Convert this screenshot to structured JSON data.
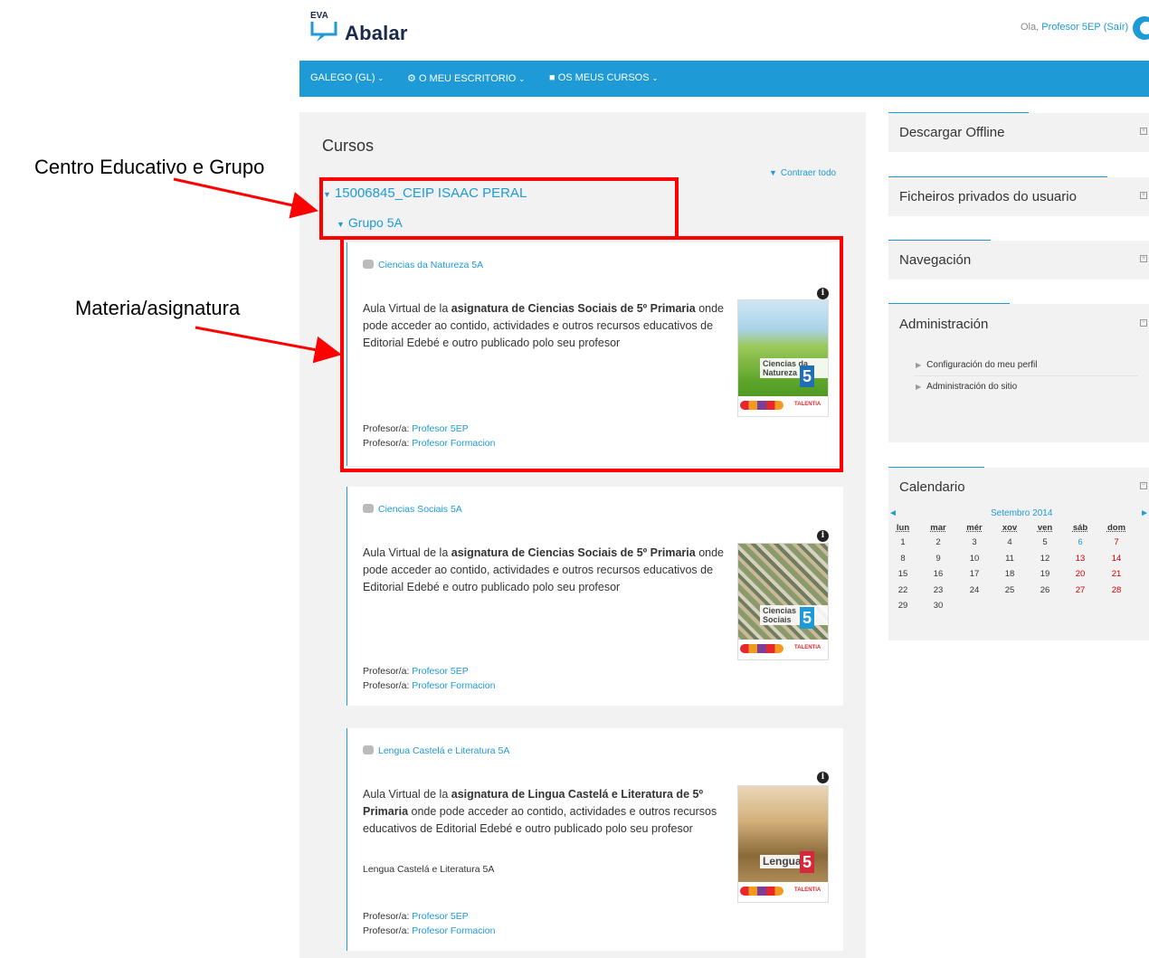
{
  "header": {
    "logo_small": "EVA",
    "logo_name": "Abalar",
    "greeting_prefix": "Ola, ",
    "user_name": "Profesor 5EP",
    "logout_label": "(Saír)"
  },
  "navbar": {
    "items": [
      {
        "label": "GALEGO (GL)",
        "icon": "chevron-down-icon"
      },
      {
        "label": "O MEU ESCRITORIO",
        "icon": "dashboard-icon"
      },
      {
        "label": "OS MEUS CURSOS",
        "icon": "briefcase-icon"
      }
    ]
  },
  "main": {
    "title": "Cursos",
    "collapse_all": "Contraer todo",
    "school": "15006845_CEIP ISAAC PERAL",
    "group": "Grupo 5A",
    "courses": [
      {
        "name": "Ciencias da Natureza 5A",
        "desc_plain_1": "Aula Virtual de la ",
        "desc_bold": "asignatura de Ciencias Sociais de 5º Primaria",
        "desc_plain_2": " onde pode acceder ao contido, actividades e outros recursos educativos de Editorial Edebé e outro publicado polo seu profesor",
        "teacher_label": "Profesor/a:",
        "teachers": [
          "Profesor 5EP",
          "Profesor Formacion"
        ],
        "book_title": "Ciencias da Natureza",
        "book_number": "5",
        "book_brand": "TALENTIA"
      },
      {
        "name": "Ciencias Sociais 5A",
        "desc_plain_1": "Aula Virtual de la ",
        "desc_bold": "asignatura de Ciencias Sociais de 5º Primaria",
        "desc_plain_2": " onde pode acceder ao contido, actividades e outros recursos educativos de Editorial Edebé e outro publicado polo seu profesor",
        "teacher_label": "Profesor/a:",
        "teachers": [
          "Profesor 5EP",
          "Profesor Formacion"
        ],
        "book_title": "Ciencias Sociais",
        "book_number": "5",
        "book_brand": "TALENTIA"
      },
      {
        "name": "Lengua Castelá e Literatura 5A",
        "desc_plain_1": "Aula Virtual de la ",
        "desc_bold": "asignatura de Lingua Castelá e Literatura de 5º Primaria",
        "desc_plain_2": " onde pode acceder ao contido, actividades e outros recursos educativos de Editorial Edebé e outro publicado polo seu profesor",
        "subname": "Lengua Castelá e Literatura 5A",
        "teacher_label": "Profesor/a:",
        "teachers": [
          "Profesor 5EP",
          "Profesor Formacion"
        ],
        "book_title": "Lengua",
        "book_number": "5",
        "book_brand": "TALENTIA"
      }
    ]
  },
  "annotations": {
    "school_group": "Centro Educativo e Grupo",
    "subject": "Materia/asignatura"
  },
  "sidebar": {
    "offline": "Descargar Offline",
    "private_files": "Ficheiros privados do usuario",
    "navigation": "Navegación",
    "administration": "Administración",
    "admin_items": [
      "Configuración do meu perfil",
      "Administración do sitio"
    ],
    "calendar": "Calendario"
  },
  "calendar": {
    "prev": "◄",
    "next": "►",
    "month": "Setembro 2014",
    "days_of_week": [
      "lun",
      "mar",
      "mér",
      "xov",
      "ven",
      "sáb",
      "dom"
    ],
    "weeks": [
      [
        "1",
        "2",
        "3",
        "4",
        "5",
        "6",
        "7"
      ],
      [
        "8",
        "9",
        "10",
        "11",
        "12",
        "13",
        "14"
      ],
      [
        "15",
        "16",
        "17",
        "18",
        "19",
        "20",
        "21"
      ],
      [
        "22",
        "23",
        "24",
        "25",
        "26",
        "27",
        "28"
      ],
      [
        "29",
        "30",
        "",
        "",
        "",
        "",
        ""
      ]
    ],
    "highlight_day": "6"
  },
  "colors": {
    "accent": "#1e9ad6",
    "annotation": "#ff0000",
    "panel_bg": "#f2f2f2"
  }
}
